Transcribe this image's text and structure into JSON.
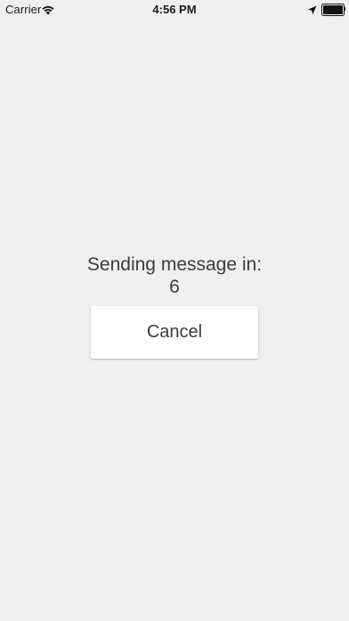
{
  "status_bar": {
    "carrier": "Carrier",
    "time": "4:56 PM"
  },
  "main": {
    "sending_label": "Sending message in:",
    "countdown": "6",
    "cancel_label": "Cancel"
  },
  "colors": {
    "background": "#efefef",
    "button_background": "#ffffff",
    "text": "#3c3c3c"
  }
}
